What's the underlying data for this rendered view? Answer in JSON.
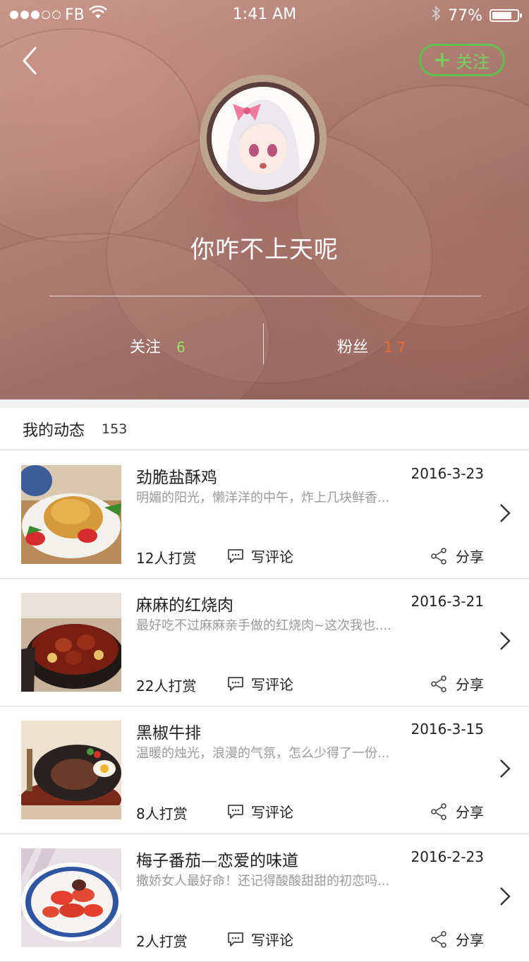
{
  "status_bar": {
    "carrier": "FB",
    "time": "1:41 AM",
    "battery": "77%",
    "battery_level": 0.77,
    "signal_bars": 3,
    "icons": [
      "signal-dots-icon",
      "wifi-icon",
      "bluetooth-icon",
      "battery-icon"
    ]
  },
  "header": {
    "back_icon": "chevron-left-icon",
    "follow_button_label": "关注",
    "follow_button_icon": "plus-icon",
    "username": "你咋不上天呢",
    "following_label": "关注",
    "following_count": "6",
    "fans_label": "粉丝",
    "fans_count": "17"
  },
  "feed": {
    "section_title": "我的动态",
    "section_count": "153",
    "comment_label": "写评论",
    "share_label": "分享",
    "items": [
      {
        "title": "劲脆盐酥鸡",
        "date": "2016-3-23",
        "desc": "明媚的阳光，懒洋洋的中午，炸上几块鲜香...",
        "tips": "12人打赏"
      },
      {
        "title": "麻麻的红烧肉",
        "date": "2016-3-21",
        "desc": "最好吃不过麻麻亲手做的红烧肉~这次我也....",
        "tips": "22人打赏"
      },
      {
        "title": "黑椒牛排",
        "date": "2016-3-15",
        "desc": "温暖的烛光，浪漫的气氛，怎么少得了一份...",
        "tips": "8人打赏"
      },
      {
        "title": "梅子番茄—恋爱的味道",
        "date": "2016-2-23",
        "desc": "撒娇女人最好命！还记得酸酸甜甜的初恋吗...",
        "tips": "2人打赏"
      }
    ]
  },
  "colors": {
    "accent_green": "#5fbf4f",
    "count_green": "#9be05a",
    "count_orange": "#ec6a2a"
  }
}
